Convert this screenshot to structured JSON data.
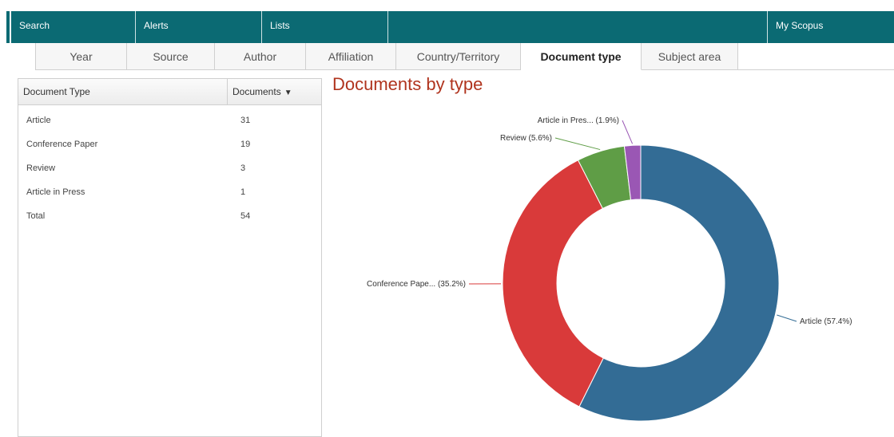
{
  "top_nav": {
    "items": [
      {
        "label": "Search"
      },
      {
        "label": "Alerts"
      },
      {
        "label": "Lists"
      },
      {
        "label": ""
      },
      {
        "label": "My Scopus"
      }
    ]
  },
  "tabs": [
    {
      "label": "Year",
      "active": false
    },
    {
      "label": "Source",
      "active": false
    },
    {
      "label": "Author",
      "active": false
    },
    {
      "label": "Affiliation",
      "active": false
    },
    {
      "label": "Country/Territory",
      "active": false
    },
    {
      "label": "Document type",
      "active": true
    },
    {
      "label": "Subject area",
      "active": false
    }
  ],
  "table": {
    "col_type": "Document Type",
    "col_docs": "Documents",
    "sort_icon": "sort-desc-icon",
    "rows": [
      {
        "type": "Article",
        "count": "31"
      },
      {
        "type": "Conference Paper",
        "count": "19"
      },
      {
        "type": "Review",
        "count": "3"
      },
      {
        "type": "Article in Press",
        "count": "1"
      },
      {
        "type": "Total",
        "count": "54"
      }
    ]
  },
  "colors": {
    "nav": "#0b6a73",
    "title": "#b0341e"
  },
  "chart_data": {
    "type": "pie",
    "donut": true,
    "title": "Documents by type",
    "slices": [
      {
        "label": "Article (57.4%)",
        "value": 57.4,
        "color": "#336c95"
      },
      {
        "label": "Conference Pape... (35.2%)",
        "value": 35.2,
        "color": "#d93a3a"
      },
      {
        "label": "Review (5.6%)",
        "value": 5.6,
        "color": "#5f9d46"
      },
      {
        "label": "Article in Pres... (1.9%)",
        "value": 1.9,
        "color": "#9a57b4"
      }
    ]
  }
}
